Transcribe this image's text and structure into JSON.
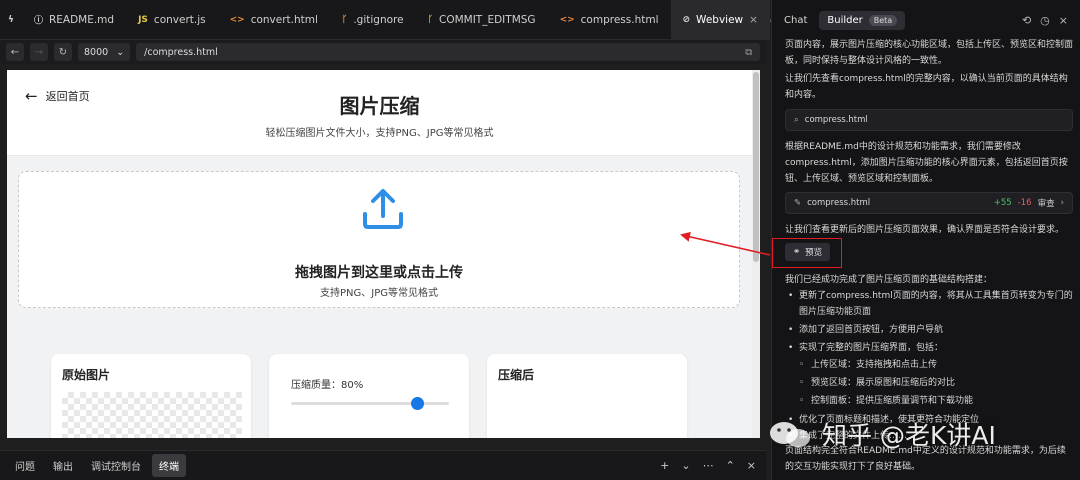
{
  "editor": {
    "tabs": [
      {
        "label": "README.md",
        "icon": "info-icon",
        "active": false
      },
      {
        "label": "convert.js",
        "icon": "js-file-icon",
        "active": false
      },
      {
        "label": "convert.html",
        "icon": "html-file-icon",
        "active": false
      },
      {
        "label": ".gitignore",
        "icon": "git-icon",
        "active": false
      },
      {
        "label": "COMMIT_EDITMSG",
        "icon": "git-icon",
        "active": false
      },
      {
        "label": "compress.html",
        "icon": "html-file-icon",
        "active": false
      },
      {
        "label": "Webview",
        "icon": "globe-icon",
        "active": true
      }
    ]
  },
  "urlbar": {
    "port": "8000",
    "path": "/compress.html"
  },
  "page": {
    "back_label": "返回首页",
    "title": "图片压缩",
    "subtitle": "轻松压缩图片文件大小，支持PNG、JPG等常见格式",
    "dropzone_title": "拖拽图片到这里或点击上传",
    "dropzone_sub": "支持PNG、JPG等常见格式",
    "original_title": "原始图片",
    "quality_label": "压缩质量：80%",
    "quality_value": 0.8,
    "compressed_title": "压缩后",
    "accent": "#1677e6"
  },
  "bottom_panel": {
    "tabs": [
      "问题",
      "输出",
      "调试控制台",
      "终端"
    ],
    "active_tab": "终端"
  },
  "chat": {
    "tab_chat": "Chat",
    "tab_builder": "Builder",
    "beta_badge": "Beta",
    "para1": "页面内容，展示图片压缩的核心功能区域，包括上传区、预览区和控制面板，同时保持与整体设计风格的一致性。",
    "para2": "让我们先查看compress.html的完整内容，以确认当前页面的具体结构和内容。",
    "search_chip": "compress.html",
    "para3": "根据README.md中的设计规范和功能需求，我们需要修改compress.html，添加图片压缩功能的核心界面元素，包括返回首页按钮、上传区域、预览区域和控制面板。",
    "file_chip": "compress.html",
    "additions": "+55",
    "deletions": "-16",
    "review_label": "审查",
    "para4": "让我们查看更新后的图片压缩页面效果，确认界面是否符合设计要求。",
    "preview_label": "预览",
    "para5": "我们已经成功完成了图片压缩页面的基础结构搭建：",
    "bullets": [
      "更新了compress.html页面的内容，将其从工具集首页转变为专门的图片压缩功能页面",
      "添加了返回首页按钮，方便用户导航",
      "实现了完整的图片压缩界面，包括："
    ],
    "subbullets": [
      "上传区域：支持拖拽和点击上传",
      "预览区域：展示原图和压缩后的对比",
      "控制面板：提供压缩质量调节和下载功能"
    ],
    "bullet4": "优化了页面标题和描述，使其更符合功能定位",
    "bullet5": "集成了完整的文件上传……",
    "para6": "页面结构完全符合README.md中定义的设计规范和功能需求，为后续的交互功能实现打下了良好基础。"
  },
  "watermark": "知乎 @老K讲AI",
  "annotation_color": "#e11d23"
}
